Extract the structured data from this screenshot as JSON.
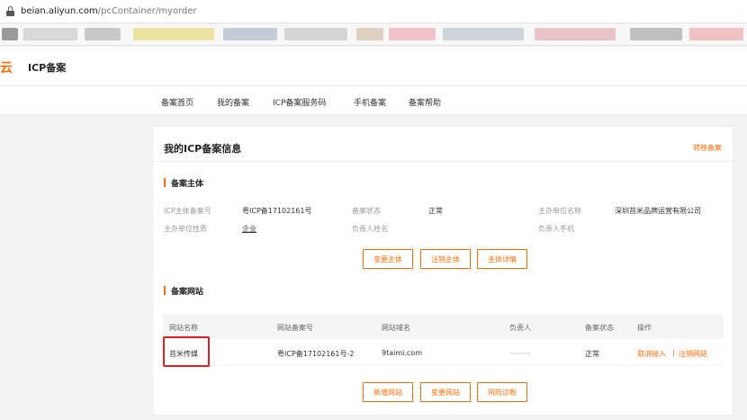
{
  "browser": {
    "url_host": "beian.aliyun.com",
    "url_path": "/pcContainer/myorder"
  },
  "header": {
    "logo_fragment": "云",
    "title": "ICP备案"
  },
  "subnav": {
    "items": [
      "备案首页",
      "我的备案",
      "ICP备案服务码",
      "手机备案",
      "备案帮助"
    ]
  },
  "card": {
    "title": "我的ICP备案信息",
    "link": "转移备案",
    "subject_section": {
      "title": "备案主体",
      "fields": [
        {
          "label": "ICP主体备案号",
          "value": "粤ICP备17102161号"
        },
        {
          "label": "备案状态",
          "value": "正常"
        },
        {
          "label": "主办单位名称",
          "value": "深圳苔米品牌运营有限公司"
        },
        {
          "label": "主办单位性质",
          "value": "企业"
        },
        {
          "label": "负责人姓名",
          "value": ""
        },
        {
          "label": "负责人手机",
          "value": ""
        }
      ],
      "buttons": [
        "变更主体",
        "注销主体",
        "主体详情"
      ]
    },
    "site_section": {
      "title": "备案网站",
      "columns": [
        "网站名称",
        "网站备案号",
        "网站域名",
        "负责人",
        "备案状态",
        "操作"
      ],
      "rows": [
        {
          "name": "苔米传媒",
          "record_no": "粤ICP备17102161号-2",
          "domain": "9taimi.com",
          "owner": "",
          "status": "正常",
          "actions": [
            "取消接入",
            "注销网站"
          ],
          "action_separator": "|"
        }
      ],
      "buttons": [
        "新增网站",
        "变更网站",
        "风险诊断"
      ]
    }
  },
  "colors": {
    "accent": "#ff6a00",
    "highlight": "#e02020"
  }
}
